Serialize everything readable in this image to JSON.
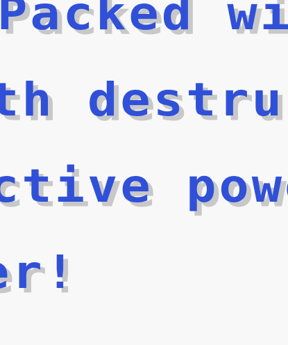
{
  "dialog": {
    "lines": [
      "Packed wi",
      "th destruc",
      "ctive powe",
      "er!"
    ]
  },
  "colors": {
    "background": "#f8f8f8",
    "text": "#3050d8",
    "text_shadow": "#c8c8c8"
  }
}
